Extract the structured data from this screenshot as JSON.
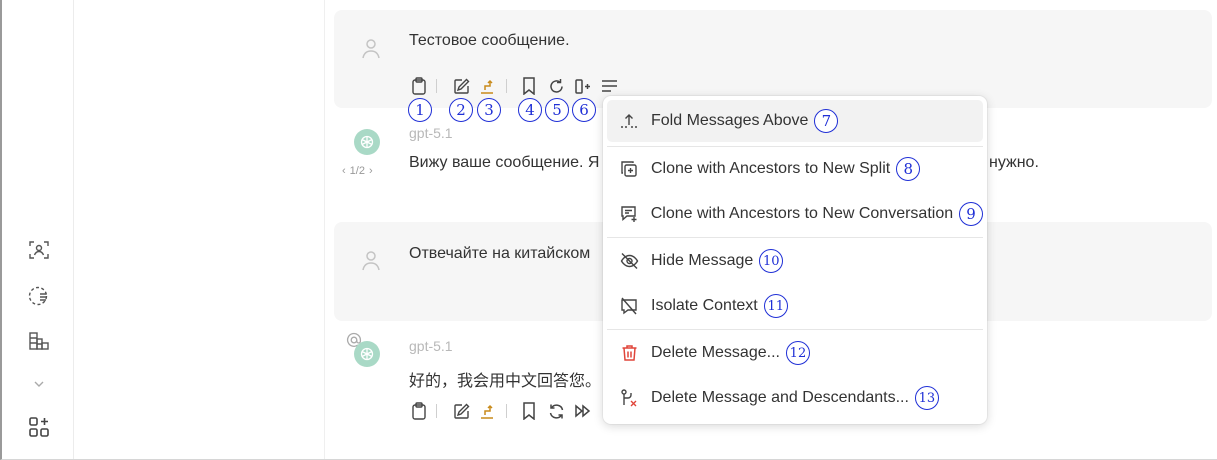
{
  "messages": {
    "m1": {
      "text": "Тестовое сообщение."
    },
    "m2": {
      "model": "gpt-5.1",
      "text": "Вижу ваше сообщение. Я",
      "text_tail": "нужно.",
      "pager": "1/2"
    },
    "m3": {
      "text": "Отвечайте на китайском"
    },
    "m4": {
      "model": "gpt-5.1",
      "text": "好的，我会用中文回答您。"
    }
  },
  "annotations": [
    "1",
    "2",
    "3",
    "4",
    "5",
    "6",
    "7",
    "8",
    "9",
    "10",
    "11",
    "12",
    "13"
  ],
  "menu": {
    "items": [
      {
        "label": "Fold Messages Above",
        "icon": "fold-up-icon",
        "badge": "7"
      },
      {
        "label": "Clone with Ancestors to New Split",
        "icon": "clone-split-icon",
        "badge": "8"
      },
      {
        "label": "Clone with Ancestors to New Conversation",
        "icon": "clone-conversation-icon",
        "badge": "9"
      },
      {
        "label": "Hide Message",
        "icon": "eye-off-icon",
        "badge": "10"
      },
      {
        "label": "Isolate Context",
        "icon": "isolate-icon",
        "badge": "11"
      },
      {
        "label": "Delete Message...",
        "icon": "trash-icon",
        "badge": "12"
      },
      {
        "label": "Delete Message and Descendants...",
        "icon": "delete-branch-icon",
        "badge": "13"
      }
    ]
  },
  "colors": {
    "accent_badge": "#1f2fd6",
    "trash": "#e0453a",
    "branch_icon": "#c88a1a",
    "user_bubble": "#f6f6f6",
    "gpt_avatar": "#a9d9c6"
  }
}
